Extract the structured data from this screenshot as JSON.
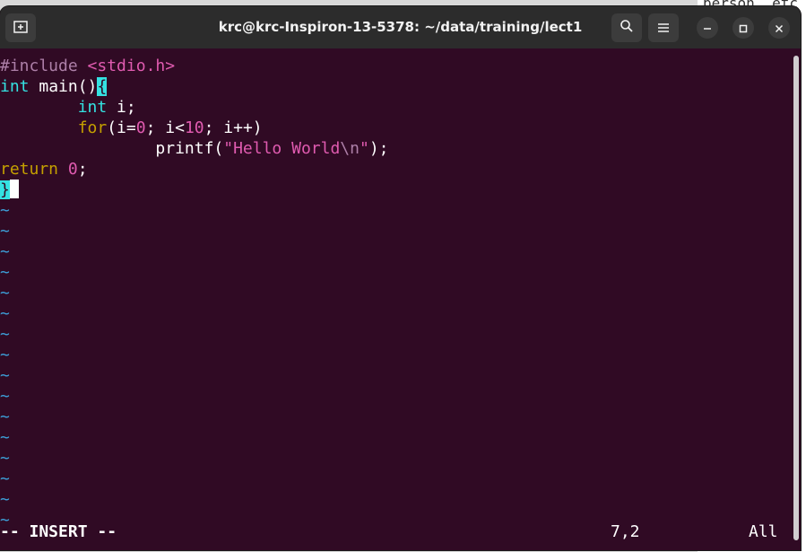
{
  "window": {
    "title": "krc@krc-Inspiron-13-5378: ~/data/training/lect1"
  },
  "titlebar": {
    "icons": [
      "new-tab-icon",
      "search-icon",
      "hamburger-menu-icon",
      "minimize-icon",
      "maximize-icon",
      "close-icon"
    ]
  },
  "background_doc": {
    "visible_text": "person  etc"
  },
  "editor": {
    "line1": {
      "directive": "#include",
      "header": "<stdio.h>"
    },
    "line2": {
      "type": "int",
      "name": " main()",
      "brace": "{"
    },
    "line3": {
      "indent": "        ",
      "type": "int",
      "rest": " i;"
    },
    "line4": {
      "indent": "        ",
      "keyword": "for",
      "p1": "(i=",
      "n1": "0",
      "p2": "; i<",
      "n2": "10",
      "p3": "; i++)"
    },
    "line5": {
      "indent": "                ",
      "func": "printf(",
      "str": "\"Hello World",
      "esc": "\\n",
      "strend": "\"",
      "end": ");"
    },
    "line6": {
      "keyword": "return",
      "space": " ",
      "num": "0",
      "end": ";"
    },
    "line7": {
      "brace": "}"
    },
    "tilde": "~"
  },
  "status": {
    "mode": "-- INSERT --",
    "position": "7,2",
    "scroll": "All"
  },
  "colors": {
    "terminal_bg": "#300a24",
    "titlebar_bg": "#2c2c2c",
    "keyword_cyan": "#34e2e2",
    "preproc_magenta": "#ad7fa8",
    "statement_yellow": "#c4a000",
    "constant_pink": "#e05bb0",
    "tilde_blue": "#3c9fd8"
  }
}
